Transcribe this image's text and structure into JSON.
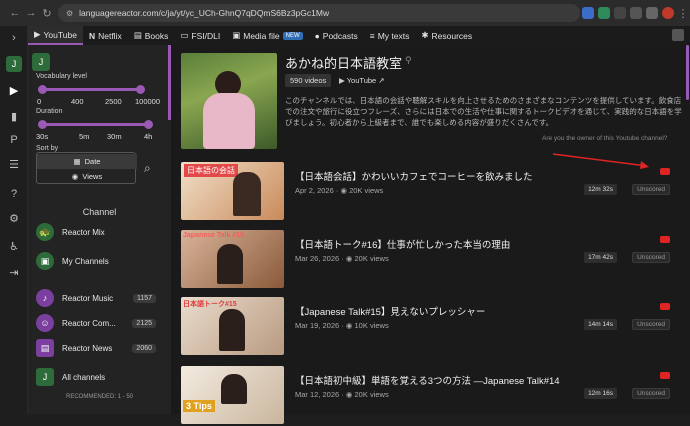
{
  "browser": {
    "url": "languagereactor.com/c/ja/yt/yc_UCh-GhnQ7qDQmS6Bz3pGc1Mw"
  },
  "tabs": [
    {
      "label": "YouTube",
      "active": true
    },
    {
      "label": "Netflix",
      "active": false
    },
    {
      "label": "Books",
      "active": false
    },
    {
      "label": "FSI/DLI",
      "active": false
    },
    {
      "label": "Media file",
      "active": false,
      "badge": "NEW"
    },
    {
      "label": "Podcasts",
      "active": false
    },
    {
      "label": "My texts",
      "active": false
    },
    {
      "label": "Resources",
      "active": false
    }
  ],
  "sidebar": {
    "avatar_letter": "J",
    "vocab_label": "Vocabulary level",
    "vocab_ticks": [
      "0",
      "400",
      "2500",
      "100000"
    ],
    "duration_label": "Duration",
    "duration_ticks": [
      "30s",
      "5m",
      "30m",
      "4h"
    ],
    "sort_label": "Sort by",
    "sort_options": [
      "Date",
      "Views"
    ],
    "channel_header": "Channel",
    "channels": [
      {
        "label": "Reactor Mix",
        "count": ""
      },
      {
        "label": "My Channels",
        "count": ""
      },
      {
        "label": "Reactor Music",
        "count": "1157"
      },
      {
        "label": "Reactor Com...",
        "count": "2125"
      },
      {
        "label": "Reactor News",
        "count": "2060"
      },
      {
        "label": "All channels",
        "count": ""
      }
    ],
    "recommended": "RECOMMENDED: 1 - 50"
  },
  "channel": {
    "title": "あかね的日本語教室",
    "videos": "590 videos",
    "youtube_label": "YouTube",
    "description": "このチャンネルでは、日本語の会話や聴解スキルを向上させるためのさまざまなコンテンツを提供しています。飲食店での注文や旅行に役立つフレーズ、さらには日本での生活や仕事に関するトークビデオを通じて、実践的な日本語を学びましょう。初心者から上級者まで、誰でも楽しめる内容が盛りだくさんです。",
    "owner_link": "Are you the owner of this Youtube channel?"
  },
  "videos": [
    {
      "title": "【日本語会話】かわいいカフェでコーヒーを飲みました",
      "date": "Apr 2, 2026",
      "views": "20K views",
      "duration": "12m 32s",
      "status": "Unscored",
      "thumb_text": "日本語の会話"
    },
    {
      "title": "【日本語トーク#16】仕事が忙しかった本当の理由",
      "date": "Mar 26, 2026",
      "views": "20K views",
      "duration": "17m 42s",
      "status": "Unscored",
      "thumb_text": "Japanese Talk #16"
    },
    {
      "title": "【Japanese Talk#15】見えないプレッシャー",
      "date": "Mar 19, 2026",
      "views": "10K views",
      "duration": "14m 14s",
      "status": "Unscored",
      "thumb_text": "日本語トーク#15"
    },
    {
      "title": "【日本語初中級】単語を覚える3つの方法 ―Japanese Talk#14",
      "date": "Mar 12, 2026",
      "views": "20K views",
      "duration": "12m 16s",
      "status": "Unscored",
      "thumb_text": "3 Tips"
    }
  ]
}
